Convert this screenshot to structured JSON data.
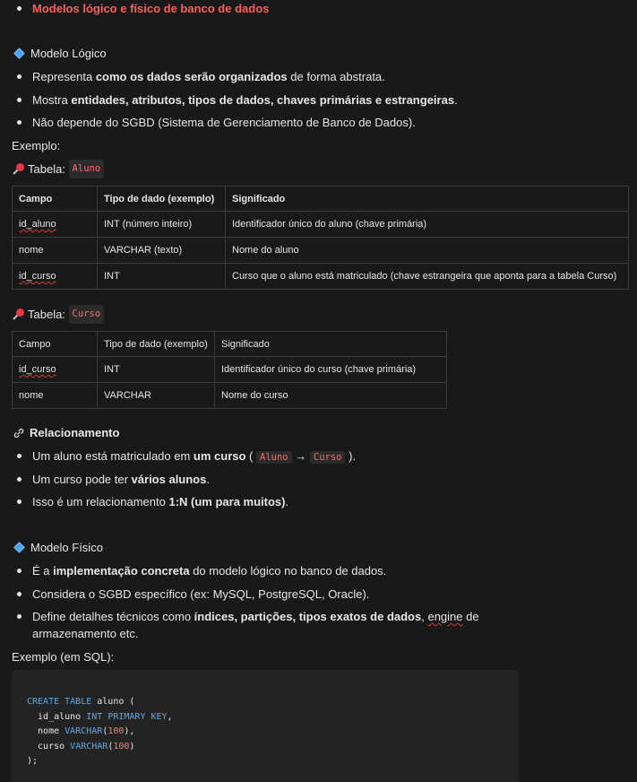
{
  "top_item": "Modelos lógico e físico de banco de dados",
  "logical": {
    "heading": "Modelo Lógico",
    "bullets": [
      {
        "pre": "Representa ",
        "bold": "como os dados serão organizados",
        "post": " de forma abstrata."
      },
      {
        "pre": "Mostra ",
        "bold": "entidades, atributos, tipos de dados, chaves primárias e estrangeiras",
        "post": "."
      },
      {
        "pre": "Não depende do SGBD (Sistema de Gerenciamento de Banco de Dados).",
        "bold": "",
        "post": ""
      }
    ],
    "example_label": "Exemplo:"
  },
  "table_aluno": {
    "label": "Tabela:",
    "name": "Aluno",
    "headers": [
      "Campo",
      "Tipo de dado (exemplo)",
      "Significado"
    ],
    "rows": [
      [
        "id_aluno",
        "INT (número inteiro)",
        "Identificador único do aluno (chave primária)"
      ],
      [
        "nome",
        "VARCHAR (texto)",
        "Nome do aluno"
      ],
      [
        "id_curso",
        "INT",
        "Curso que o aluno está matriculado (chave estrangeira que aponta para a tabela Curso)"
      ]
    ]
  },
  "table_curso": {
    "label": "Tabela:",
    "name": "Curso",
    "headers": [
      "Campo",
      "Tipo de dado (exemplo)",
      "Significado"
    ],
    "rows": [
      [
        "id_curso",
        "INT",
        "Identificador único do curso (chave primária)"
      ],
      [
        "nome",
        "VARCHAR",
        "Nome do curso"
      ]
    ]
  },
  "relationship": {
    "heading": "Relacionamento",
    "b1_pre": "Um aluno está matriculado em ",
    "b1_bold": "um curso",
    "b1_open": " (",
    "b1_code1": "Aluno",
    "b1_arrow": "→",
    "b1_code2": "Curso",
    "b1_close": ").",
    "b2_pre": "Um curso pode ter ",
    "b2_bold": "vários alunos",
    "b2_post": ".",
    "b3_pre": "Isso é um relacionamento ",
    "b3_bold": "1:N (um para muitos)",
    "b3_post": "."
  },
  "physical": {
    "heading": "Modelo Físico",
    "b1_pre": "É a ",
    "b1_bold": "implementação concreta",
    "b1_post": " do modelo lógico no banco de dados.",
    "b2": "Considera o SGBD específico (ex: MySQL, PostgreSQL, Oracle).",
    "b3_pre": "Define detalhes técnicos como ",
    "b3_bold": "índices, partições, tipos exatos de dados",
    "b3_mid": ", ",
    "b3_sq": "engine",
    "b3_post": " de",
    "b3_line2": "armazenamento etc.",
    "example_label": "Exemplo (em SQL):"
  },
  "sql": {
    "l1_kw": "CREATE TABLE",
    "l1_rest": " aluno (",
    "l2_name": "  id_aluno ",
    "l2_kw": "INT PRIMARY KEY",
    "l2_end": ",",
    "l3_name": "  nome ",
    "l3_kw": "VARCHAR",
    "l3_open": "(",
    "l3_num": "100",
    "l3_end": "),",
    "l4_name": "  curso ",
    "l4_kw": "VARCHAR",
    "l4_open": "(",
    "l4_num": "100",
    "l4_end": ")",
    "l5": ");"
  }
}
